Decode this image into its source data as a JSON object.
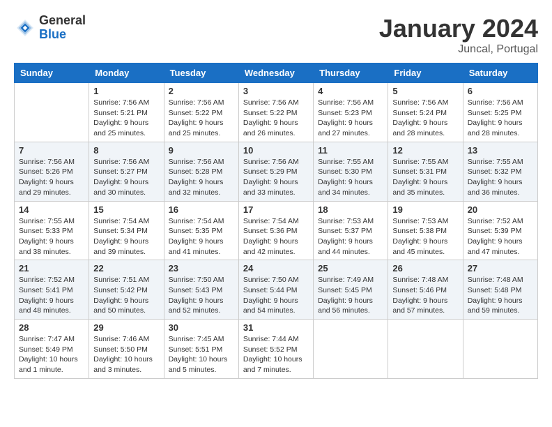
{
  "logo": {
    "general": "General",
    "blue": "Blue"
  },
  "header": {
    "month": "January 2024",
    "location": "Juncal, Portugal"
  },
  "days_of_week": [
    "Sunday",
    "Monday",
    "Tuesday",
    "Wednesday",
    "Thursday",
    "Friday",
    "Saturday"
  ],
  "weeks": [
    [
      {
        "day": "",
        "info": ""
      },
      {
        "day": "1",
        "info": "Sunrise: 7:56 AM\nSunset: 5:21 PM\nDaylight: 9 hours\nand 25 minutes."
      },
      {
        "day": "2",
        "info": "Sunrise: 7:56 AM\nSunset: 5:22 PM\nDaylight: 9 hours\nand 25 minutes."
      },
      {
        "day": "3",
        "info": "Sunrise: 7:56 AM\nSunset: 5:22 PM\nDaylight: 9 hours\nand 26 minutes."
      },
      {
        "day": "4",
        "info": "Sunrise: 7:56 AM\nSunset: 5:23 PM\nDaylight: 9 hours\nand 27 minutes."
      },
      {
        "day": "5",
        "info": "Sunrise: 7:56 AM\nSunset: 5:24 PM\nDaylight: 9 hours\nand 28 minutes."
      },
      {
        "day": "6",
        "info": "Sunrise: 7:56 AM\nSunset: 5:25 PM\nDaylight: 9 hours\nand 28 minutes."
      }
    ],
    [
      {
        "day": "7",
        "info": "Sunrise: 7:56 AM\nSunset: 5:26 PM\nDaylight: 9 hours\nand 29 minutes."
      },
      {
        "day": "8",
        "info": "Sunrise: 7:56 AM\nSunset: 5:27 PM\nDaylight: 9 hours\nand 30 minutes."
      },
      {
        "day": "9",
        "info": "Sunrise: 7:56 AM\nSunset: 5:28 PM\nDaylight: 9 hours\nand 32 minutes."
      },
      {
        "day": "10",
        "info": "Sunrise: 7:56 AM\nSunset: 5:29 PM\nDaylight: 9 hours\nand 33 minutes."
      },
      {
        "day": "11",
        "info": "Sunrise: 7:55 AM\nSunset: 5:30 PM\nDaylight: 9 hours\nand 34 minutes."
      },
      {
        "day": "12",
        "info": "Sunrise: 7:55 AM\nSunset: 5:31 PM\nDaylight: 9 hours\nand 35 minutes."
      },
      {
        "day": "13",
        "info": "Sunrise: 7:55 AM\nSunset: 5:32 PM\nDaylight: 9 hours\nand 36 minutes."
      }
    ],
    [
      {
        "day": "14",
        "info": "Sunrise: 7:55 AM\nSunset: 5:33 PM\nDaylight: 9 hours\nand 38 minutes."
      },
      {
        "day": "15",
        "info": "Sunrise: 7:54 AM\nSunset: 5:34 PM\nDaylight: 9 hours\nand 39 minutes."
      },
      {
        "day": "16",
        "info": "Sunrise: 7:54 AM\nSunset: 5:35 PM\nDaylight: 9 hours\nand 41 minutes."
      },
      {
        "day": "17",
        "info": "Sunrise: 7:54 AM\nSunset: 5:36 PM\nDaylight: 9 hours\nand 42 minutes."
      },
      {
        "day": "18",
        "info": "Sunrise: 7:53 AM\nSunset: 5:37 PM\nDaylight: 9 hours\nand 44 minutes."
      },
      {
        "day": "19",
        "info": "Sunrise: 7:53 AM\nSunset: 5:38 PM\nDaylight: 9 hours\nand 45 minutes."
      },
      {
        "day": "20",
        "info": "Sunrise: 7:52 AM\nSunset: 5:39 PM\nDaylight: 9 hours\nand 47 minutes."
      }
    ],
    [
      {
        "day": "21",
        "info": "Sunrise: 7:52 AM\nSunset: 5:41 PM\nDaylight: 9 hours\nand 48 minutes."
      },
      {
        "day": "22",
        "info": "Sunrise: 7:51 AM\nSunset: 5:42 PM\nDaylight: 9 hours\nand 50 minutes."
      },
      {
        "day": "23",
        "info": "Sunrise: 7:50 AM\nSunset: 5:43 PM\nDaylight: 9 hours\nand 52 minutes."
      },
      {
        "day": "24",
        "info": "Sunrise: 7:50 AM\nSunset: 5:44 PM\nDaylight: 9 hours\nand 54 minutes."
      },
      {
        "day": "25",
        "info": "Sunrise: 7:49 AM\nSunset: 5:45 PM\nDaylight: 9 hours\nand 56 minutes."
      },
      {
        "day": "26",
        "info": "Sunrise: 7:48 AM\nSunset: 5:46 PM\nDaylight: 9 hours\nand 57 minutes."
      },
      {
        "day": "27",
        "info": "Sunrise: 7:48 AM\nSunset: 5:48 PM\nDaylight: 9 hours\nand 59 minutes."
      }
    ],
    [
      {
        "day": "28",
        "info": "Sunrise: 7:47 AM\nSunset: 5:49 PM\nDaylight: 10 hours\nand 1 minute."
      },
      {
        "day": "29",
        "info": "Sunrise: 7:46 AM\nSunset: 5:50 PM\nDaylight: 10 hours\nand 3 minutes."
      },
      {
        "day": "30",
        "info": "Sunrise: 7:45 AM\nSunset: 5:51 PM\nDaylight: 10 hours\nand 5 minutes."
      },
      {
        "day": "31",
        "info": "Sunrise: 7:44 AM\nSunset: 5:52 PM\nDaylight: 10 hours\nand 7 minutes."
      },
      {
        "day": "",
        "info": ""
      },
      {
        "day": "",
        "info": ""
      },
      {
        "day": "",
        "info": ""
      }
    ]
  ]
}
